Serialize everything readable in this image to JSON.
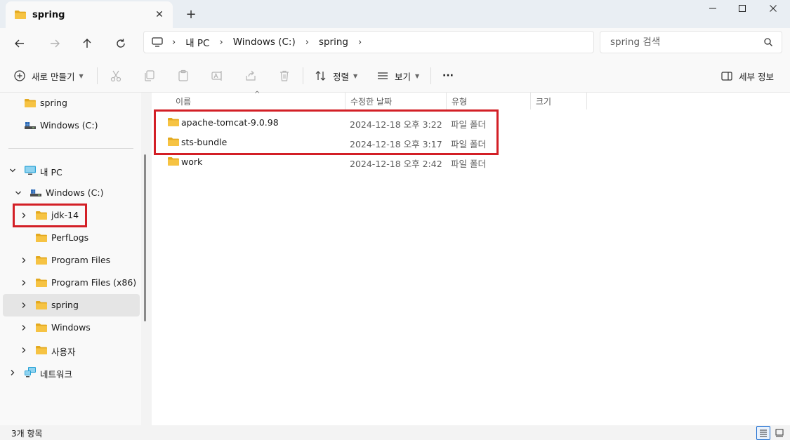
{
  "window": {
    "tab_title": "spring",
    "tab_close": "✕",
    "new_tab": "+"
  },
  "address": {
    "crumbs": [
      "내 PC",
      "Windows (C:)",
      "spring"
    ]
  },
  "search": {
    "placeholder": "spring 검색"
  },
  "toolbar": {
    "new_label": "새로 만들기",
    "sort_label": "정렬",
    "view_label": "보기",
    "more_label": "···",
    "details_label": "세부 정보"
  },
  "sidebar": {
    "quick": [
      {
        "label": "spring",
        "icon": "folder-icon"
      },
      {
        "label": "Windows (C:)",
        "icon": "drive-icon"
      }
    ],
    "this_pc": {
      "label": "내 PC",
      "icon": "computer-icon"
    },
    "drive": {
      "label": "Windows (C:)",
      "icon": "drive-icon"
    },
    "folders": [
      {
        "label": "jdk-14"
      },
      {
        "label": "PerfLogs"
      },
      {
        "label": "Program Files"
      },
      {
        "label": "Program Files (x86)"
      },
      {
        "label": "spring"
      },
      {
        "label": "Windows"
      },
      {
        "label": "사용자"
      }
    ],
    "network": {
      "label": "네트워크",
      "icon": "network-icon"
    }
  },
  "columns": {
    "name": "이름",
    "date": "수정한 날짜",
    "type": "유형",
    "size": "크기"
  },
  "files": [
    {
      "name": "apache-tomcat-9.0.98",
      "date": "2024-12-18 오후 3:22",
      "type": "파일 폴더"
    },
    {
      "name": "sts-bundle",
      "date": "2024-12-18 오후 3:17",
      "type": "파일 폴더"
    },
    {
      "name": "work",
      "date": "2024-12-18 오후 2:42",
      "type": "파일 폴더"
    }
  ],
  "status": {
    "count": "3개 항목"
  },
  "colors": {
    "folder": "#f6c343",
    "folder_dark": "#e3a91f",
    "highlight": "#d31f26",
    "accent": "#1f6fd1"
  }
}
